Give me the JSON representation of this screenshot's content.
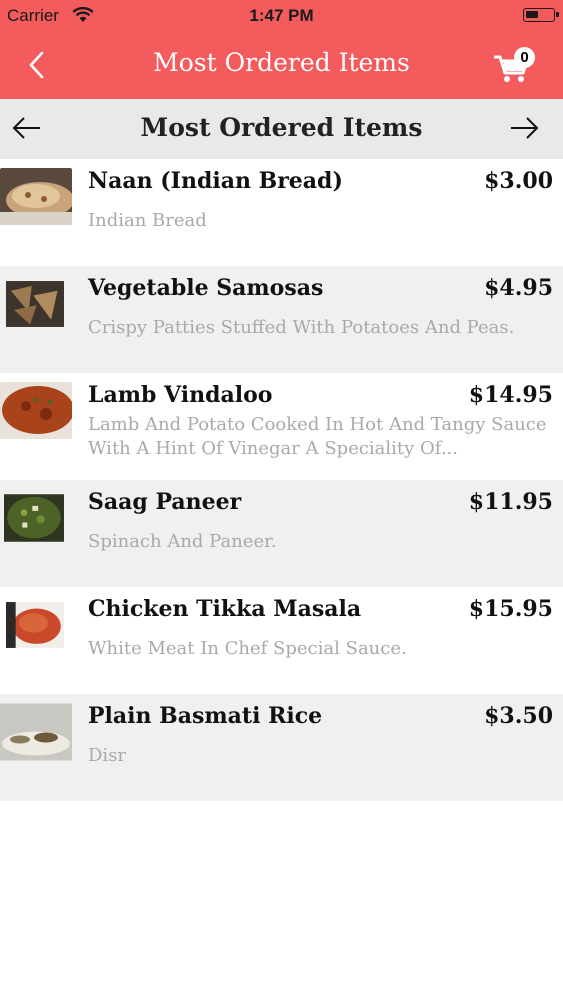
{
  "status_bar": {
    "carrier": "Carrier",
    "time": "1:47 PM",
    "wifi_icon": "wifi-icon",
    "battery_icon": "battery-icon"
  },
  "nav_bar": {
    "title": "Most Ordered Items",
    "back_icon": "chevron-left-icon",
    "cart_icon": "cart-icon",
    "cart_count": "0"
  },
  "section_header": {
    "title": "Most Ordered Items",
    "prev_icon": "arrow-left-icon",
    "next_icon": "arrow-right-icon"
  },
  "items": [
    {
      "name": "Naan (Indian Bread)",
      "price": "$3.00",
      "description": "Indian Bread"
    },
    {
      "name": "Vegetable Samosas",
      "price": "$4.95",
      "description": "Crispy Patties Stuffed With Potatoes And Peas."
    },
    {
      "name": "Lamb Vindaloo",
      "price": "$14.95",
      "description": "Lamb And Potato Cooked In Hot And Tangy Sauce With A Hint Of Vinegar A Speciality Of..."
    },
    {
      "name": "Saag Paneer",
      "price": "$11.95",
      "description": "Spinach And Paneer."
    },
    {
      "name": "Chicken Tikka Masala",
      "price": "$15.95",
      "description": "White Meat In Chef Special Sauce."
    },
    {
      "name": "Plain Basmati Rice",
      "price": "$3.50",
      "description": "Disr"
    }
  ],
  "colors": {
    "accent": "#f45b5d",
    "header_bg": "#e9e9e9",
    "alt_row_bg": "#f0f0f0",
    "description_text": "#a9a9a9"
  }
}
